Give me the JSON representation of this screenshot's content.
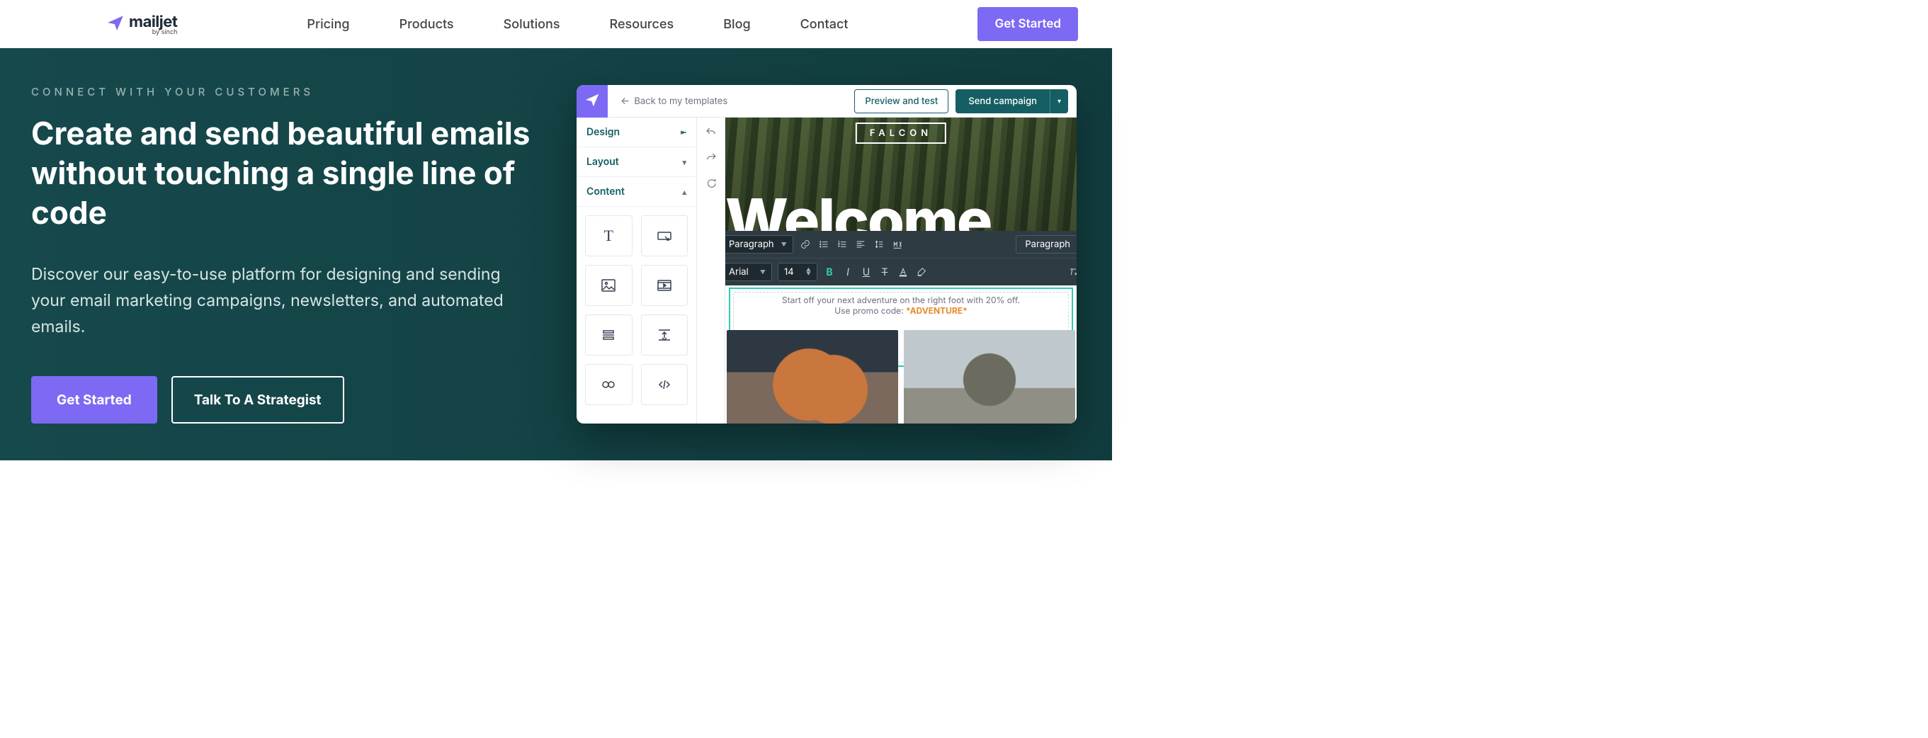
{
  "brand": {
    "name": "mailjet",
    "subline": "by sinch"
  },
  "nav": {
    "items": [
      "Pricing",
      "Products",
      "Solutions",
      "Resources",
      "Blog",
      "Contact"
    ],
    "cta": "Get Started"
  },
  "hero": {
    "eyebrow": "CONNECT WITH YOUR CUSTOMERS",
    "headline_l1": "Create and send beautiful emails",
    "headline_l2": "without touching a single line of code",
    "subcopy": "Discover our easy-to-use platform for designing and sending your email marketing campaigns, newsletters, and automated emails.",
    "primary_btn": "Get Started",
    "secondary_btn": "Talk To A Strategist"
  },
  "editor": {
    "back_link": "Back to my templates",
    "preview_btn": "Preview and test",
    "send_btn": "Send campaign",
    "palette": {
      "design": "Design",
      "layout": "Layout",
      "content": "Content"
    },
    "toolbar": {
      "style": "Paragraph",
      "font": "Arial",
      "size": "14",
      "pill": "Paragraph"
    },
    "canvas": {
      "brand_mark": "FALCON",
      "headline": "Welcome",
      "promo_line1": "Start off your next adventure on the right foot with 20% off.",
      "promo_line2_a": "Use promo code: ",
      "promo_code": "*ADVENTURE*"
    }
  }
}
